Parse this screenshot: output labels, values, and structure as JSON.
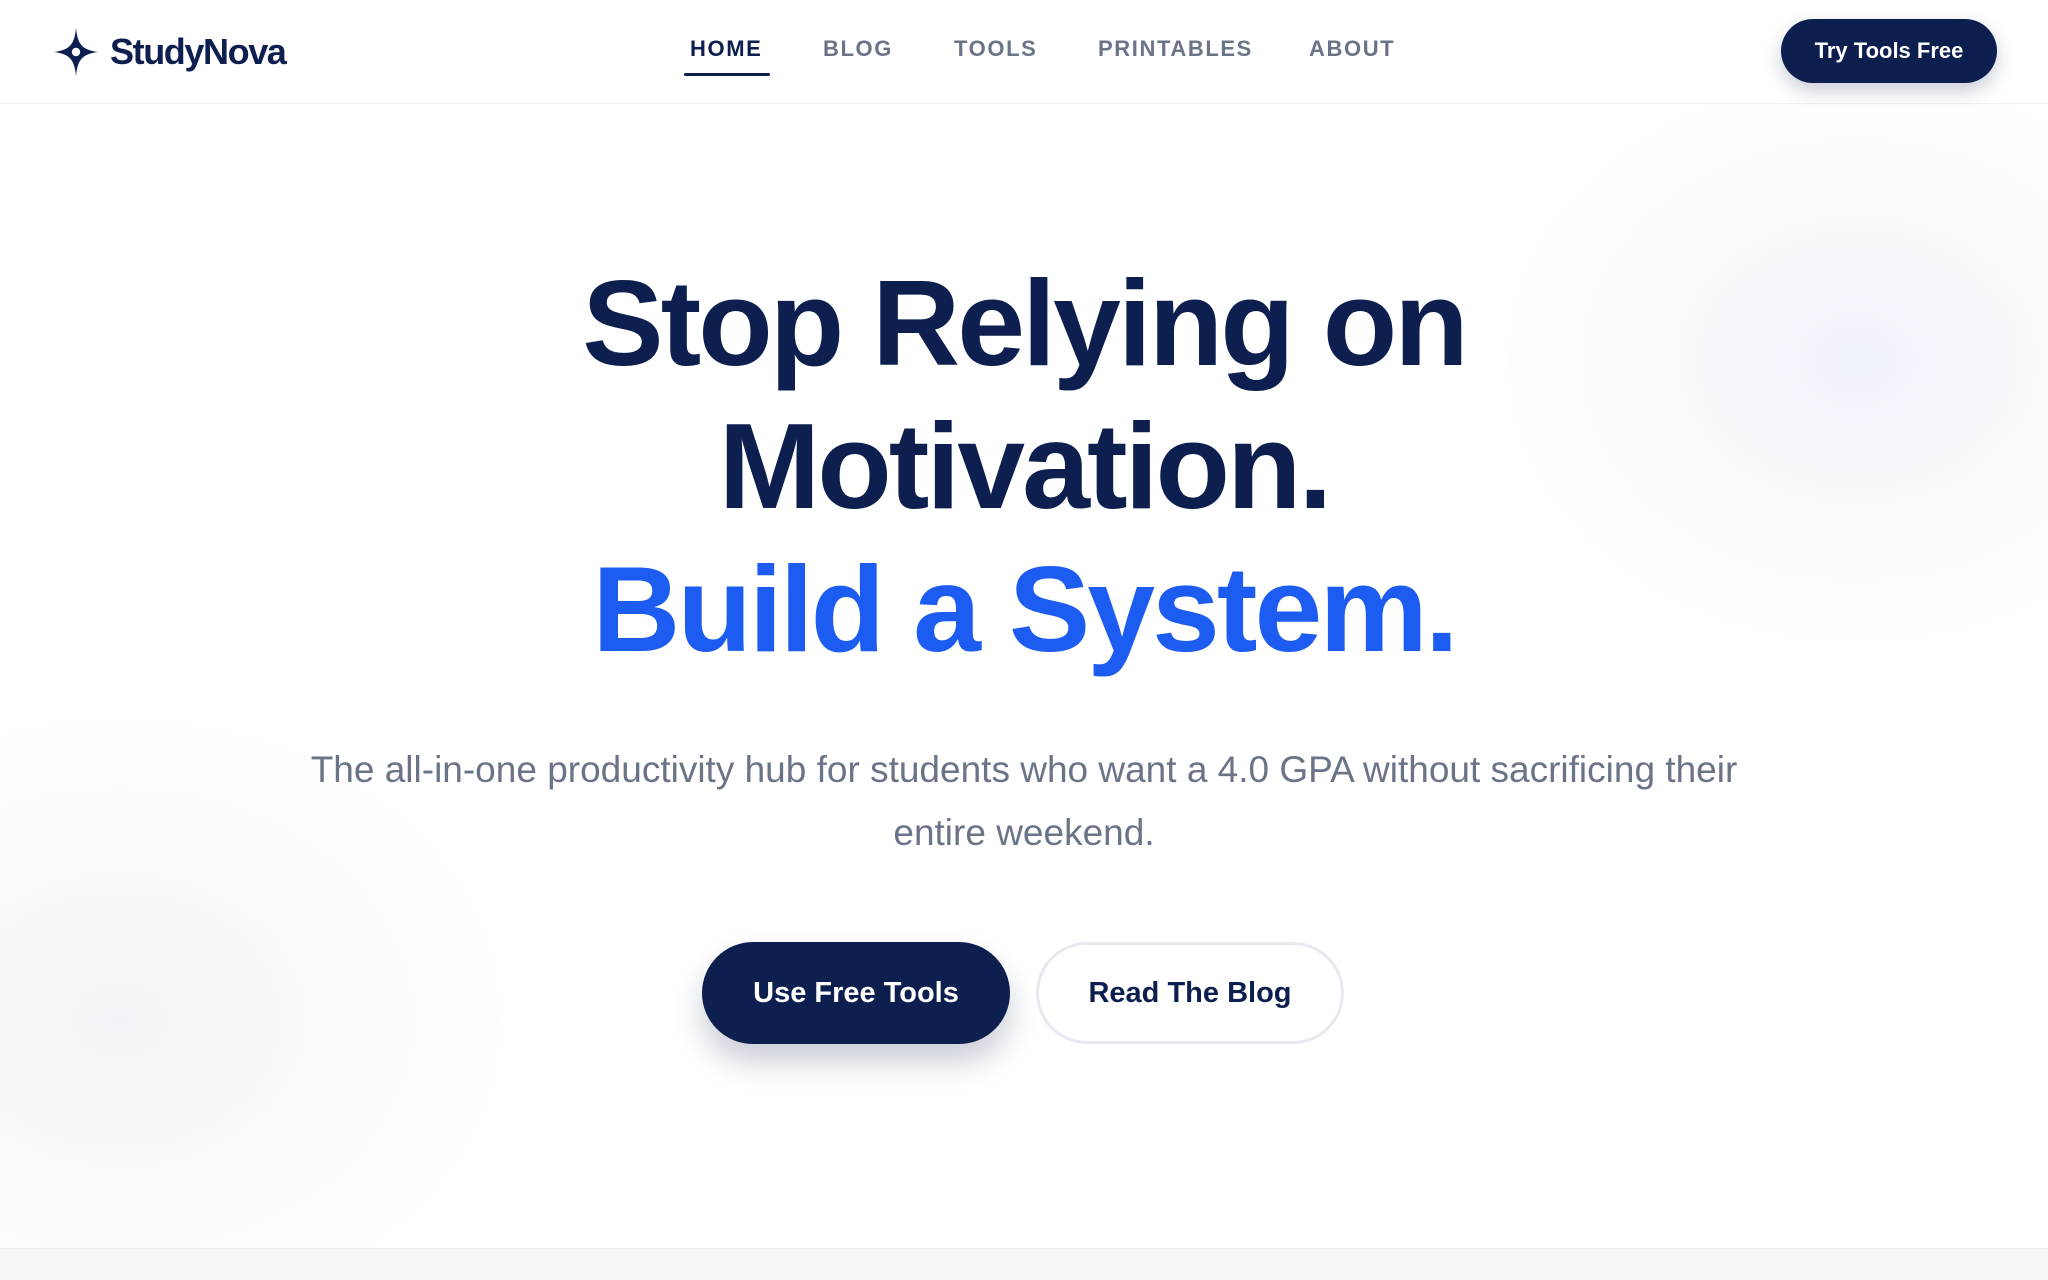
{
  "brand": {
    "name": "StudyNova",
    "icon": "four-point-star-icon",
    "color": "#0d1f4f"
  },
  "nav": {
    "items": [
      {
        "label": "HOME",
        "active": true
      },
      {
        "label": "BLOG",
        "active": false
      },
      {
        "label": "TOOLS",
        "active": false
      },
      {
        "label": "PRINTABLES",
        "active": false
      },
      {
        "label": "ABOUT",
        "active": false
      }
    ],
    "cta_label": "Try Tools Free"
  },
  "hero": {
    "title_line_1": "Stop Relying on",
    "title_line_2": "Motivation.",
    "title_accent": "Build a System.",
    "subtitle": "The all-in-one productivity hub for students who want a 4.0 GPA without sacrificing their entire weekend.",
    "primary_button": "Use Free Tools",
    "secondary_button": "Read The Blog"
  },
  "colors": {
    "navy": "#0d1f4f",
    "accent_blue": "#1d5cf0",
    "muted_text": "#6b7386"
  }
}
